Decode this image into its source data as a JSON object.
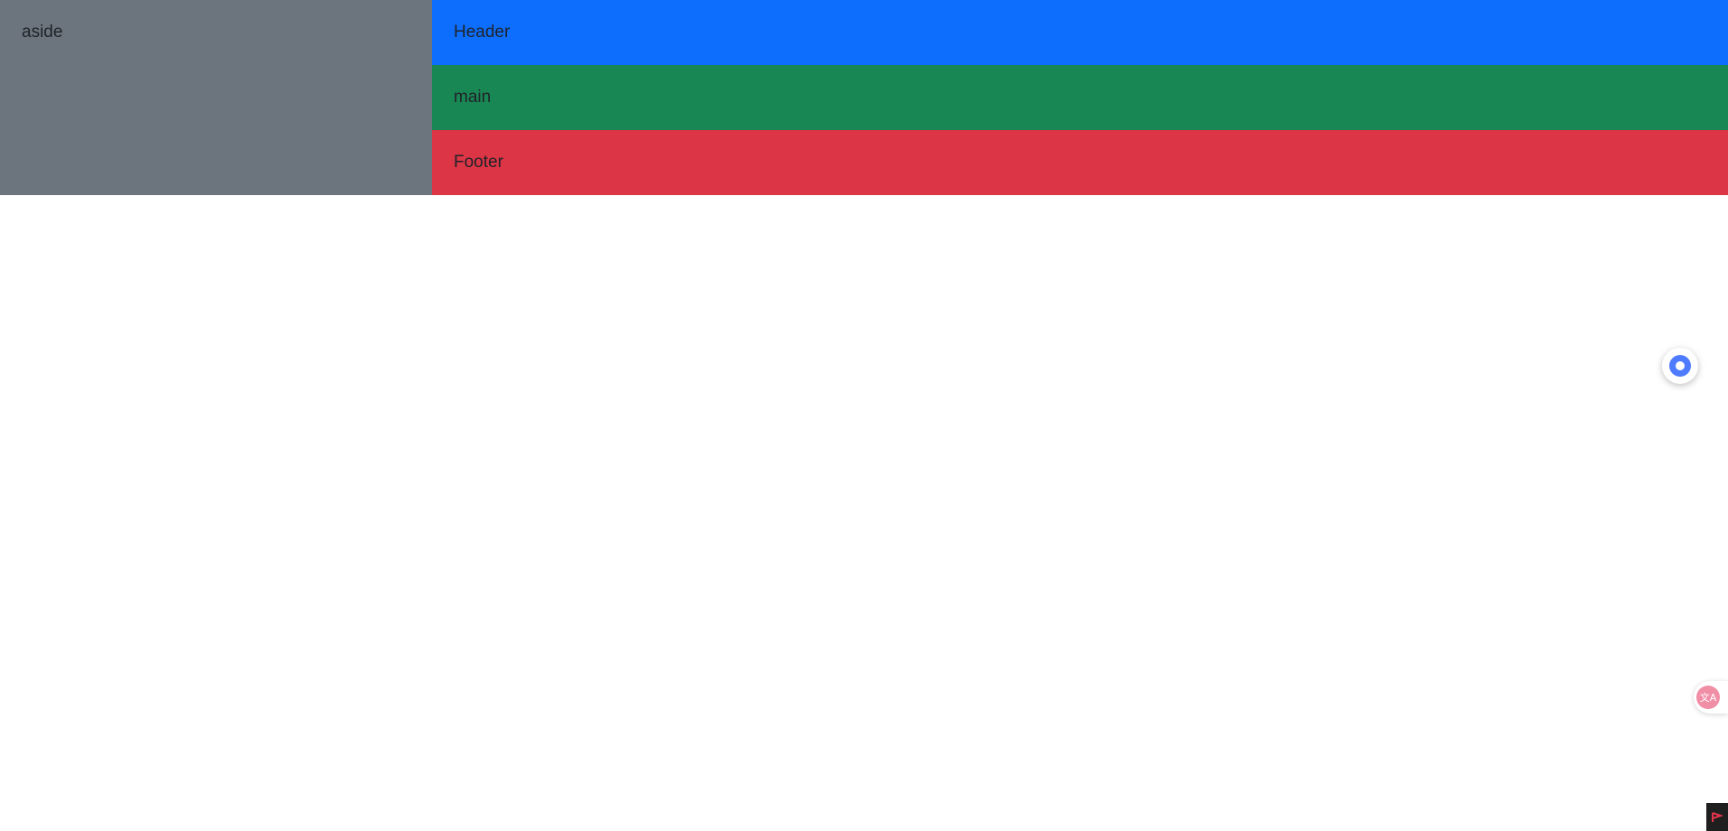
{
  "layout": {
    "aside": {
      "label": "aside",
      "color": "#6c757d"
    },
    "header": {
      "label": "Header",
      "color": "#0d6efd"
    },
    "main": {
      "label": "main",
      "color": "#198754"
    },
    "footer": {
      "label": "Footer",
      "color": "#dc3545"
    }
  },
  "widgets": {
    "float_ball": {
      "icon": "assistant-bubble-icon",
      "color": "#4f7cff"
    },
    "translate": {
      "icon": "translate-icon",
      "glyph": "文A",
      "color": "#f08ea6"
    },
    "corner": {
      "icon": "flag-icon",
      "color": "#1f1f1f",
      "accent": "#e3344a"
    }
  }
}
